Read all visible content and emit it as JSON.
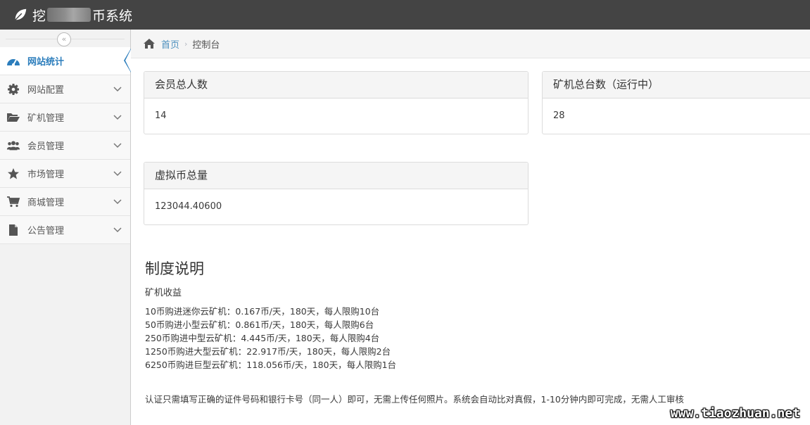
{
  "header": {
    "title_prefix": "挖",
    "title_suffix": "币系统"
  },
  "sidebar": {
    "items": [
      {
        "label": "网站统计",
        "icon": "dashboard-icon",
        "active": true
      },
      {
        "label": "网站配置",
        "icon": "gear-icon"
      },
      {
        "label": "矿机管理",
        "icon": "folder-open-icon"
      },
      {
        "label": "会员管理",
        "icon": "users-icon"
      },
      {
        "label": "市场管理",
        "icon": "star-icon"
      },
      {
        "label": "商城管理",
        "icon": "cart-icon"
      },
      {
        "label": "公告管理",
        "icon": "file-icon"
      }
    ]
  },
  "breadcrumb": {
    "home": "首页",
    "current": "控制台"
  },
  "stats": {
    "members": {
      "title": "会员总人数",
      "value": "14"
    },
    "miners": {
      "title": "矿机总台数（运行中）",
      "value": "28"
    },
    "coins": {
      "title": "虚拟币总量",
      "value": "123044.40600"
    }
  },
  "rules": {
    "title": "制度说明",
    "subtitle": "矿机收益",
    "lines": [
      "10币购进迷你云矿机：0.167币/天，180天，每人限购10台",
      "50币购进小型云矿机：0.861币/天，180天，每人限购6台",
      "250币购进中型云矿机：4.445币/天，180天，每人限购4台",
      "1250币购进大型云矿机：22.917币/天，180天，每人限购2台",
      "6250币购进巨型云矿机：118.056币/天，180天，每人限购1台"
    ],
    "note": "认证只需填写正确的证件号码和银行卡号（同一人）即可，无需上传任何照片。系统会自动比对真假，1-10分钟内即可完成，无需人工审核"
  },
  "watermark": "www.tiaozhuan.net",
  "colors": {
    "topbar": "#444444",
    "accent": "#2b7dbc",
    "link": "#4c8fbd"
  }
}
